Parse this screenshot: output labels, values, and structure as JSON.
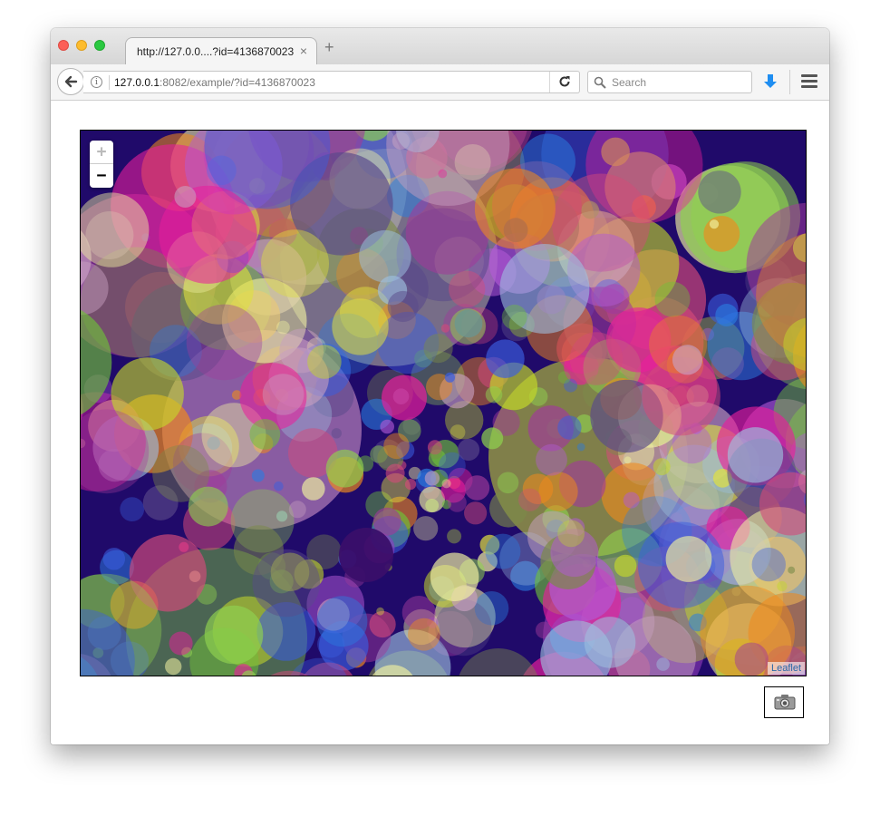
{
  "browser": {
    "tab": {
      "title": "http://127.0.0....?id=4136870023",
      "close_glyph": "×"
    },
    "new_tab_glyph": "+",
    "url": {
      "host": "127.0.0.1",
      "rest": ":8082/example/?id=4136870023"
    },
    "info_glyph": "i",
    "search": {
      "placeholder": "Search"
    },
    "icons": [
      "back-arrow-icon",
      "info-icon",
      "reload-icon",
      "search-icon",
      "download-icon",
      "hamburger-menu-icon"
    ]
  },
  "map": {
    "zoom_in": "+",
    "zoom_out": "−",
    "attribution": "Leaflet",
    "background": "#200a6a"
  },
  "screenshot_button": {
    "icon": "camera-icon"
  }
}
